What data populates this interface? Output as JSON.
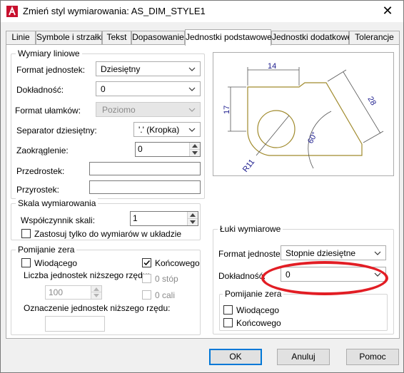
{
  "window": {
    "title": "Zmień styl wymiarowania: AS_DIM_STYLE1",
    "close_glyph": "✕"
  },
  "tabs": [
    {
      "label": "Linie",
      "active": false
    },
    {
      "label": "Symbole i strzałki",
      "active": false
    },
    {
      "label": "Tekst",
      "active": false
    },
    {
      "label": "Dopasowanie",
      "active": false
    },
    {
      "label": "Jednostki podstawowe",
      "active": true
    },
    {
      "label": "Jednostki dodatkowe",
      "active": false
    },
    {
      "label": "Tolerancje",
      "active": false
    }
  ],
  "linear": {
    "group_title": "Wymiary liniowe",
    "unit_format_label": "Format jednostek:",
    "unit_format_value": "Dziesiętny",
    "precision_label": "Dokładność:",
    "precision_value": "0",
    "fraction_format_label": "Format ułamków:",
    "fraction_format_value": "Poziomo",
    "decimal_separator_label": "Separator dziesiętny:",
    "decimal_separator_value": "'.' (Kropka)",
    "round_off_label": "Zaokrąglenie:",
    "round_off_value": "0",
    "prefix_label": "Przedrostek:",
    "prefix_value": "",
    "suffix_label": "Przyrostek:",
    "suffix_value": ""
  },
  "scale": {
    "group_title": "Skala wymiarowania",
    "factor_label": "Współczynnik skali:",
    "factor_value": "1",
    "layout_only_label": "Zastosuj tylko do wymiarów w układzie",
    "layout_only_checked": false
  },
  "zero_suppression": {
    "group_title": "Pomijanie zera",
    "leading_label": "Wiodącego",
    "leading_checked": false,
    "trailing_label": "Końcowego",
    "trailing_checked": true,
    "sub_units_factor_label": "Liczba jednostek niższego rzędu:",
    "sub_units_factor_value": "100",
    "feet_label": "0 stóp",
    "feet_checked": false,
    "inches_label": "0 cali",
    "inches_checked": false,
    "sub_unit_suffix_label": "Oznaczenie jednostek niższego rzędu:",
    "sub_unit_suffix_value": ""
  },
  "preview": {
    "dim_top": "14",
    "dim_left": "17",
    "dim_right": "28",
    "dim_angle": "60°",
    "dim_radius": "R11"
  },
  "angular": {
    "group_title": "Łuki wymiarowe",
    "unit_format_label": "Format jednostek:",
    "unit_format_value": "Stopnie dziesiętne",
    "precision_label": "Dokładność:",
    "precision_value": "0",
    "zero_group_title": "Pomijanie zera",
    "leading_label": "Wiodącego",
    "leading_checked": false,
    "trailing_label": "Końcowego",
    "trailing_checked": false
  },
  "buttons": {
    "ok": "OK",
    "cancel": "Anuluj",
    "help": "Pomoc"
  },
  "colors": {
    "annotation_ring": "#e21d24",
    "preview_geometry": "#a08a2c",
    "preview_dimension": "#1a1a8c"
  }
}
